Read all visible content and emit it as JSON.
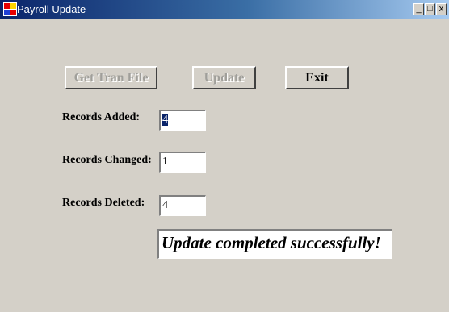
{
  "window": {
    "title": "Payroll Update",
    "controls": {
      "minimize": "_",
      "maximize": "□",
      "close": "x"
    }
  },
  "buttons": {
    "get_tran_file": "Get Tran File",
    "update": "Update",
    "exit": "Exit"
  },
  "fields": {
    "added_label": "Records Added:",
    "added_value": "4",
    "changed_label": "Records Changed:",
    "changed_value": "1",
    "deleted_label": "Records Deleted:",
    "deleted_value": "4"
  },
  "status": {
    "message": "Update completed successfully!"
  }
}
